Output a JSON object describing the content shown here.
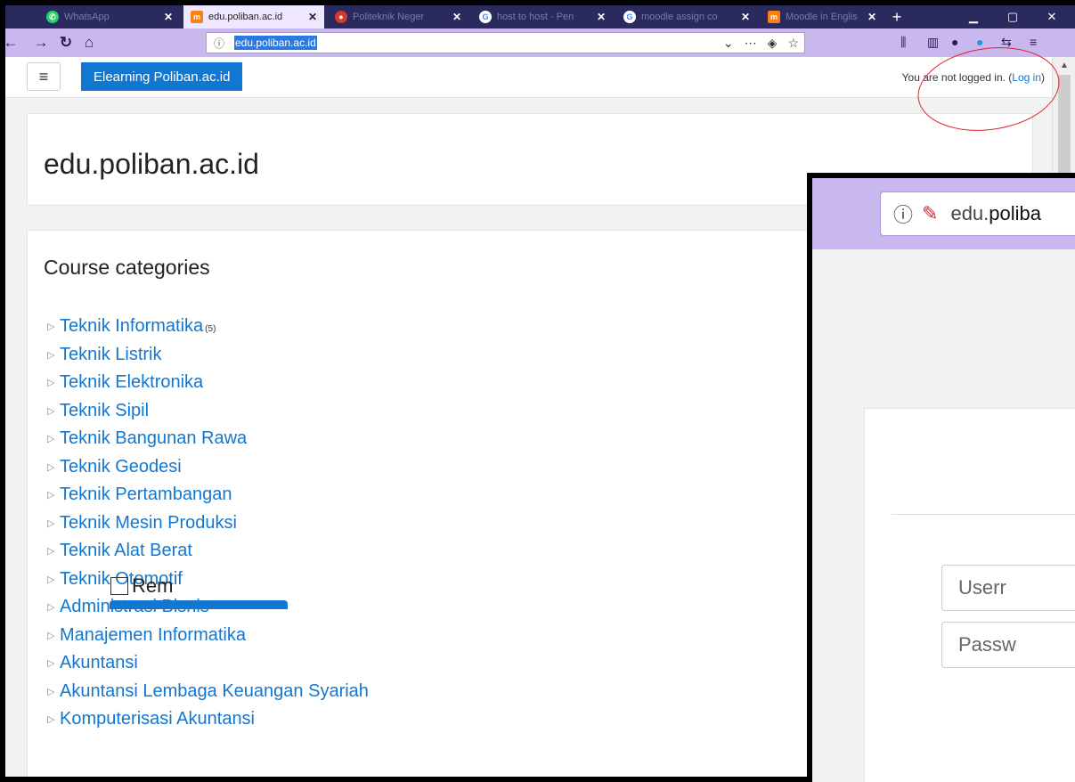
{
  "tabs": [
    {
      "title": "WhatsApp",
      "icon": "whatsapp-icon",
      "color": "#25d366",
      "active": false
    },
    {
      "title": "edu.poliban.ac.id",
      "icon": "moodle-icon",
      "color": "#f98012",
      "active": true
    },
    {
      "title": "Politeknik Neger",
      "icon": "poliban-icon",
      "color": "#d9392b",
      "active": false
    },
    {
      "title": "host to host - Pen",
      "icon": "google-icon",
      "color": "#4285f4",
      "active": false
    },
    {
      "title": "moodle assign co",
      "icon": "google-icon",
      "color": "#4285f4",
      "active": false
    },
    {
      "title": "Moodle in Englis",
      "icon": "moodle-icon",
      "color": "#f98012",
      "active": false
    }
  ],
  "navbar": {
    "url": "edu.poliban.ac.id"
  },
  "header": {
    "site_button": "Elearning Poliban.ac.id",
    "login_prefix": "You are not logged in. (",
    "login_link": "Log in",
    "login_suffix": ")"
  },
  "site_title": "edu.poliban.ac.id",
  "categories": {
    "heading": "Course categories",
    "items": [
      {
        "name": "Teknik Informatika",
        "count": "(5)"
      },
      {
        "name": "Teknik Listrik"
      },
      {
        "name": "Teknik Elektronika"
      },
      {
        "name": "Teknik Sipil"
      },
      {
        "name": "Teknik Bangunan Rawa"
      },
      {
        "name": "Teknik Geodesi"
      },
      {
        "name": "Teknik Pertambangan"
      },
      {
        "name": "Teknik Mesin Produksi"
      },
      {
        "name": "Teknik Alat Berat"
      },
      {
        "name": "Teknik Otomotif"
      },
      {
        "name": "Administrasi Bisnis"
      },
      {
        "name": "Manajemen Informatika"
      },
      {
        "name": "Akuntansi"
      },
      {
        "name": "Akuntansi Lembaga Keuangan Syariah"
      },
      {
        "name": "Komputerisasi Akuntansi"
      }
    ]
  },
  "overlay": {
    "url_plain": "edu.",
    "url_bold": "poliba",
    "username_placeholder": "Userr",
    "password_placeholder": "Passw",
    "remember_label": "Rem"
  },
  "colors": {
    "brand": "#1177d1",
    "annotation": "#e0202a"
  }
}
